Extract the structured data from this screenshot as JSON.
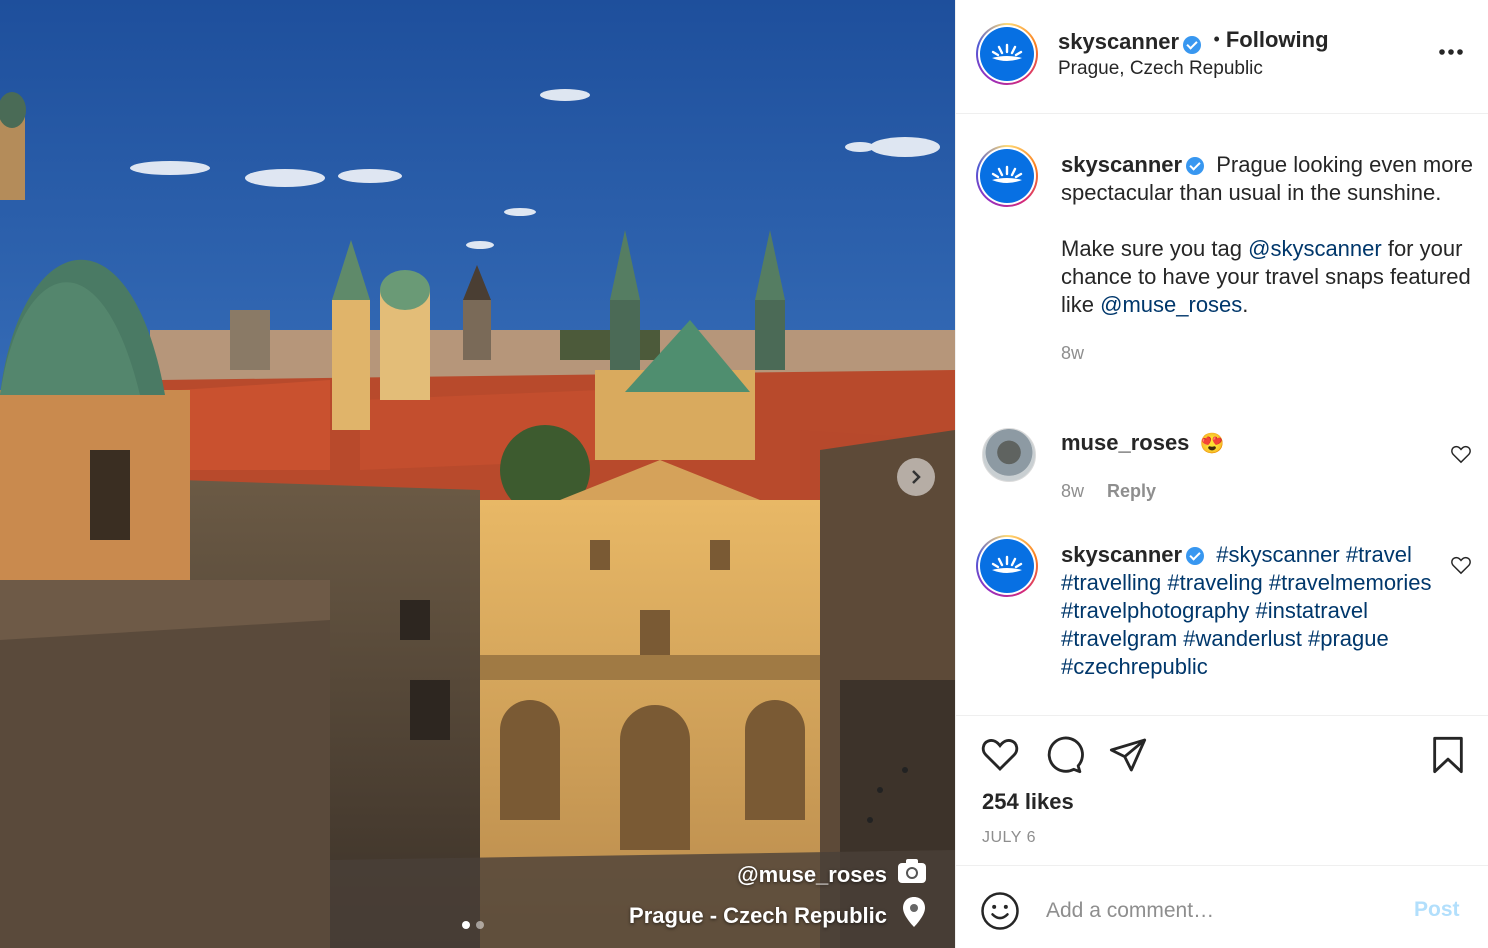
{
  "photo": {
    "credit": "@muse_roses",
    "location": "Prague - Czech Republic",
    "carousel": {
      "count": 2,
      "active": 0
    },
    "icons": {
      "camera": "camera-icon",
      "pin": "map-pin-icon",
      "next": "chevron-right-icon"
    }
  },
  "header": {
    "username": "skyscanner",
    "follow_separator": "•",
    "follow_label": "Following",
    "location": "Prague, Czech Republic",
    "more_icon": "more-horizontal-icon"
  },
  "caption": {
    "username": "skyscanner",
    "line1": "Prague looking even more spectacular than usual in the sunshine.",
    "line2_before": "Make sure you tag ",
    "line2_mention": "@skyscanner",
    "line2_middle": " for your chance to have your travel snaps featured like ",
    "line2_mention2": "@muse_roses",
    "line2_after": ".",
    "age": "8w"
  },
  "comments": [
    {
      "username": "muse_roses",
      "text": "😍",
      "age": "8w",
      "reply_label": "Reply"
    },
    {
      "username": "skyscanner",
      "text": "#skyscanner #travel #travelling #traveling #travelmemories #travelphotography #instatravel #travelgram #wanderlust #prague #czechrepublic"
    }
  ],
  "actions": {
    "likes": "254 likes",
    "date": "JULY 6",
    "icons": [
      "heart-icon",
      "comment-icon",
      "share-icon",
      "bookmark-icon"
    ]
  },
  "comment_box": {
    "placeholder": "Add a comment…",
    "post_label": "Post"
  },
  "colors": {
    "link": "#00376b",
    "verified": "#3897f0",
    "brand": "#0770e3",
    "muted": "#8e8e8e",
    "post_disabled": "#b2dffc"
  }
}
